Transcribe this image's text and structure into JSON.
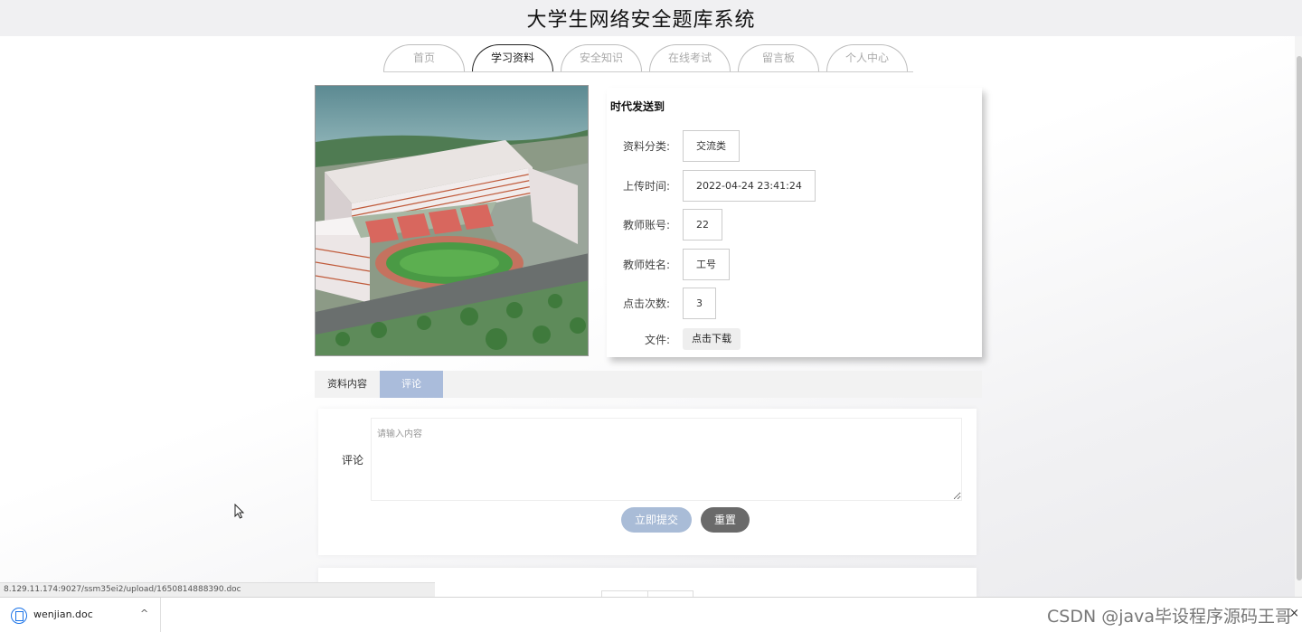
{
  "site": {
    "title": "大学生网络安全题库系统"
  },
  "nav": {
    "items": [
      "首页",
      "学习资料",
      "安全知识",
      "在线考试",
      "留言板",
      "个人中心"
    ],
    "active_index": 1
  },
  "material": {
    "title": "时代发送到",
    "fields": [
      {
        "label": "资料分类:",
        "value": "交流类"
      },
      {
        "label": "上传时间:",
        "value": "2022-04-24 23:41:24"
      },
      {
        "label": "教师账号:",
        "value": "22"
      },
      {
        "label": "教师姓名:",
        "value": "工号"
      },
      {
        "label": "点击次数:",
        "value": "3"
      }
    ],
    "file_label": "文件:",
    "download_label": "点击下载"
  },
  "tabs": {
    "content": "资料内容",
    "comment": "评论"
  },
  "comment_form": {
    "label": "评论",
    "placeholder": "请输入内容",
    "submit_label": "立即提交",
    "reset_label": "重置"
  },
  "browser": {
    "status_url": "8.129.11.174:9027/ssm35ei2/upload/1650814888390.doc",
    "download_filename": "wenjian.doc",
    "download_caret": "^",
    "close_glyph": "×"
  },
  "watermark": "CSDN @java毕设程序源码王哥",
  "colors": {
    "accent": "#a9bcd7",
    "tab_active": "#aabcdb",
    "reset": "#6a6a6a"
  }
}
